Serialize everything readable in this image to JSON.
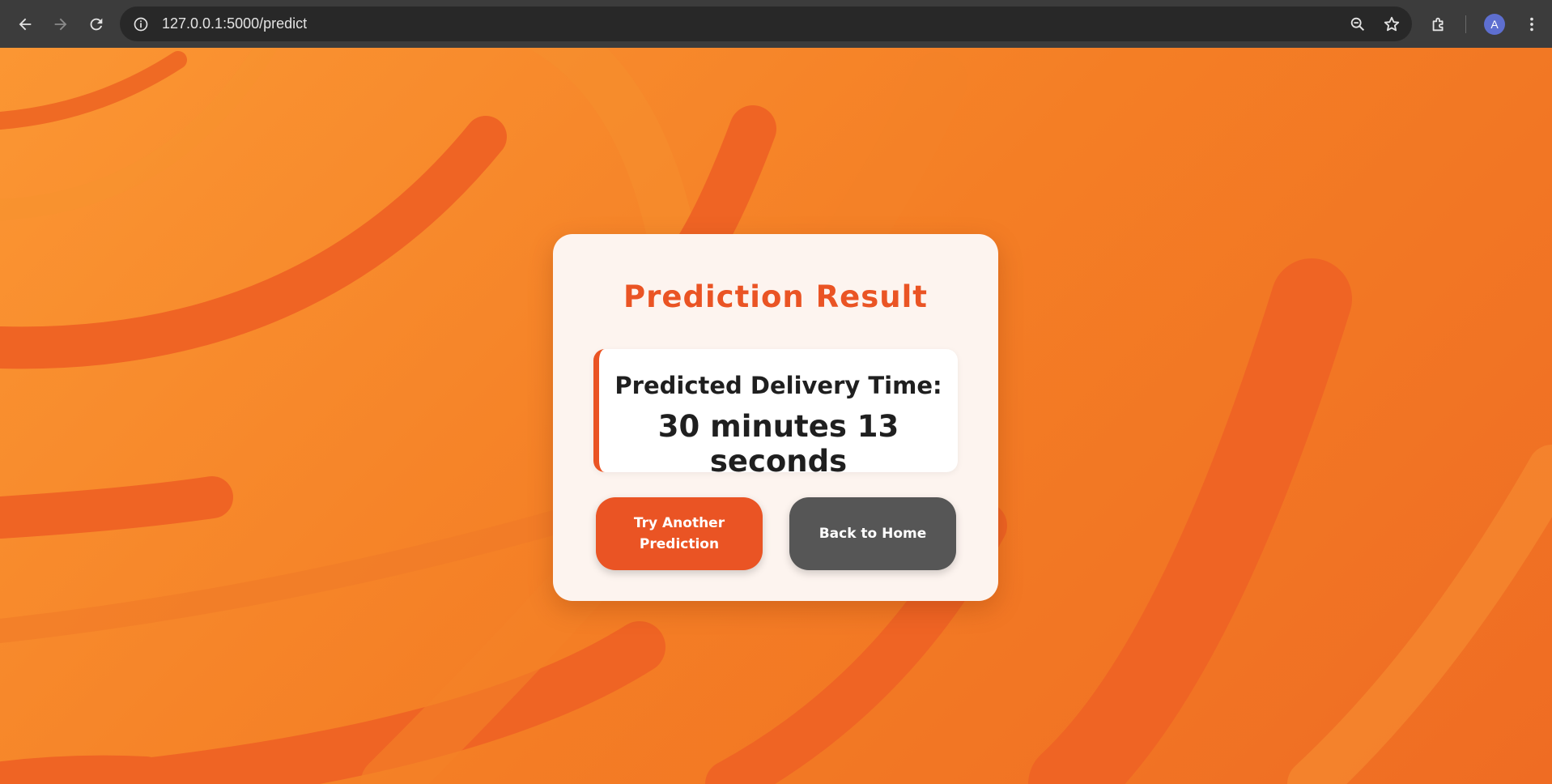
{
  "browser": {
    "url": "127.0.0.1:5000/predict",
    "profile_initial": "A",
    "icons": [
      "back-icon",
      "forward-icon",
      "reload-icon",
      "info-icon",
      "zoom-icon",
      "star-icon",
      "extensions-icon",
      "menu-icon"
    ]
  },
  "colors": {
    "accent": "#ea5424",
    "background": "#f47e25",
    "card": "#fdf4ef",
    "secondary_button": "#565656"
  },
  "result": {
    "title": "Prediction Result",
    "label": "Predicted Delivery Time:",
    "value": "30 minutes 13 seconds"
  },
  "buttons": {
    "try_again": "Try Another Prediction",
    "home": "Back to Home"
  }
}
